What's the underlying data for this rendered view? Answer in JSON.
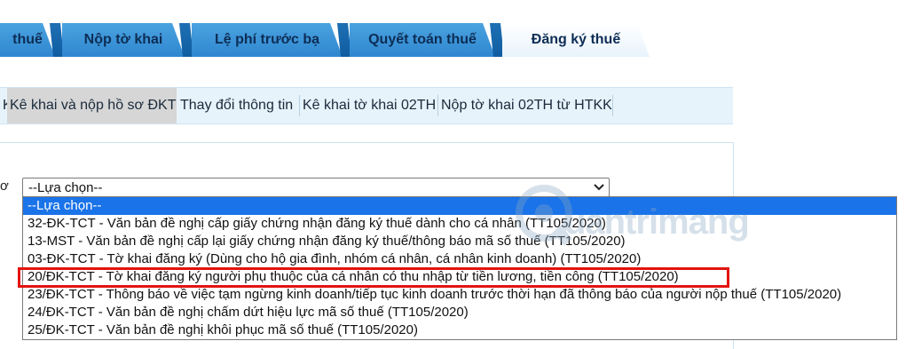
{
  "tabs": [
    {
      "label": "thuế",
      "active": false
    },
    {
      "label": "Nộp tờ khai",
      "active": false
    },
    {
      "label": "Lệ phí trước bạ",
      "active": false
    },
    {
      "label": "Quyết toán thuế",
      "active": false
    },
    {
      "label": "Đăng ký thuế",
      "active": true
    }
  ],
  "subnav": {
    "items": [
      {
        "label": "K",
        "active": false
      },
      {
        "label": "Kê khai và nộp hồ sơ ĐKT",
        "active": true
      },
      {
        "label": "Thay đổi thông tin",
        "active": false
      },
      {
        "label": "Kê khai tờ khai 02TH",
        "active": false
      },
      {
        "label": "Nộp tờ khai 02TH từ HTKK",
        "active": false
      }
    ]
  },
  "form": {
    "field_label": "ơ",
    "select_value": "--Lựa chọn--"
  },
  "dropdown": {
    "options": [
      {
        "label": "--Lựa chọn--",
        "selected": true
      },
      {
        "label": "32-ĐK-TCT - Văn bản đề nghị cấp giấy chứng nhận đăng ký thuế dành cho cá nhân (TT105/2020)",
        "selected": false
      },
      {
        "label": "13-MST - Văn bản đề nghị cấp lại giấy chứng nhận đăng ký thuế/thông báo mã số thuế (TT105/2020)",
        "selected": false
      },
      {
        "label": "03-ĐK-TCT - Tờ khai đăng ký (Dùng cho hộ gia đình, nhóm cá nhân, cá nhân kinh doanh) (TT105/2020)",
        "selected": false
      },
      {
        "label": "20/ĐK-TCT - Tờ khai đăng ký người phụ thuộc của cá nhân có thu nhập từ tiền lương, tiền công (TT105/2020)",
        "selected": false
      },
      {
        "label": "23/ĐK-TCT - Thông báo về việc tạm ngừng kinh doanh/tiếp tục kinh doanh trước thời hạn đã thông báo của người nộp thuế (TT105/2020)",
        "selected": false
      },
      {
        "label": "24/ĐK-TCT - Văn bản đề nghị chấm dứt hiệu lực mã số thuế (TT105/2020)",
        "selected": false
      },
      {
        "label": "25/ĐK-TCT - Văn bản đề nghị khôi phục mã số thuế (TT105/2020)",
        "selected": false
      }
    ]
  },
  "watermark": {
    "text": "uantrimang",
    "icon": "watermark-logo-icon"
  },
  "colors": {
    "tab_blue": "#2f86cf",
    "selected_option": "#1a73e8",
    "highlight_red": "#e3130f",
    "subnav_bg": "#e7f3fb"
  }
}
